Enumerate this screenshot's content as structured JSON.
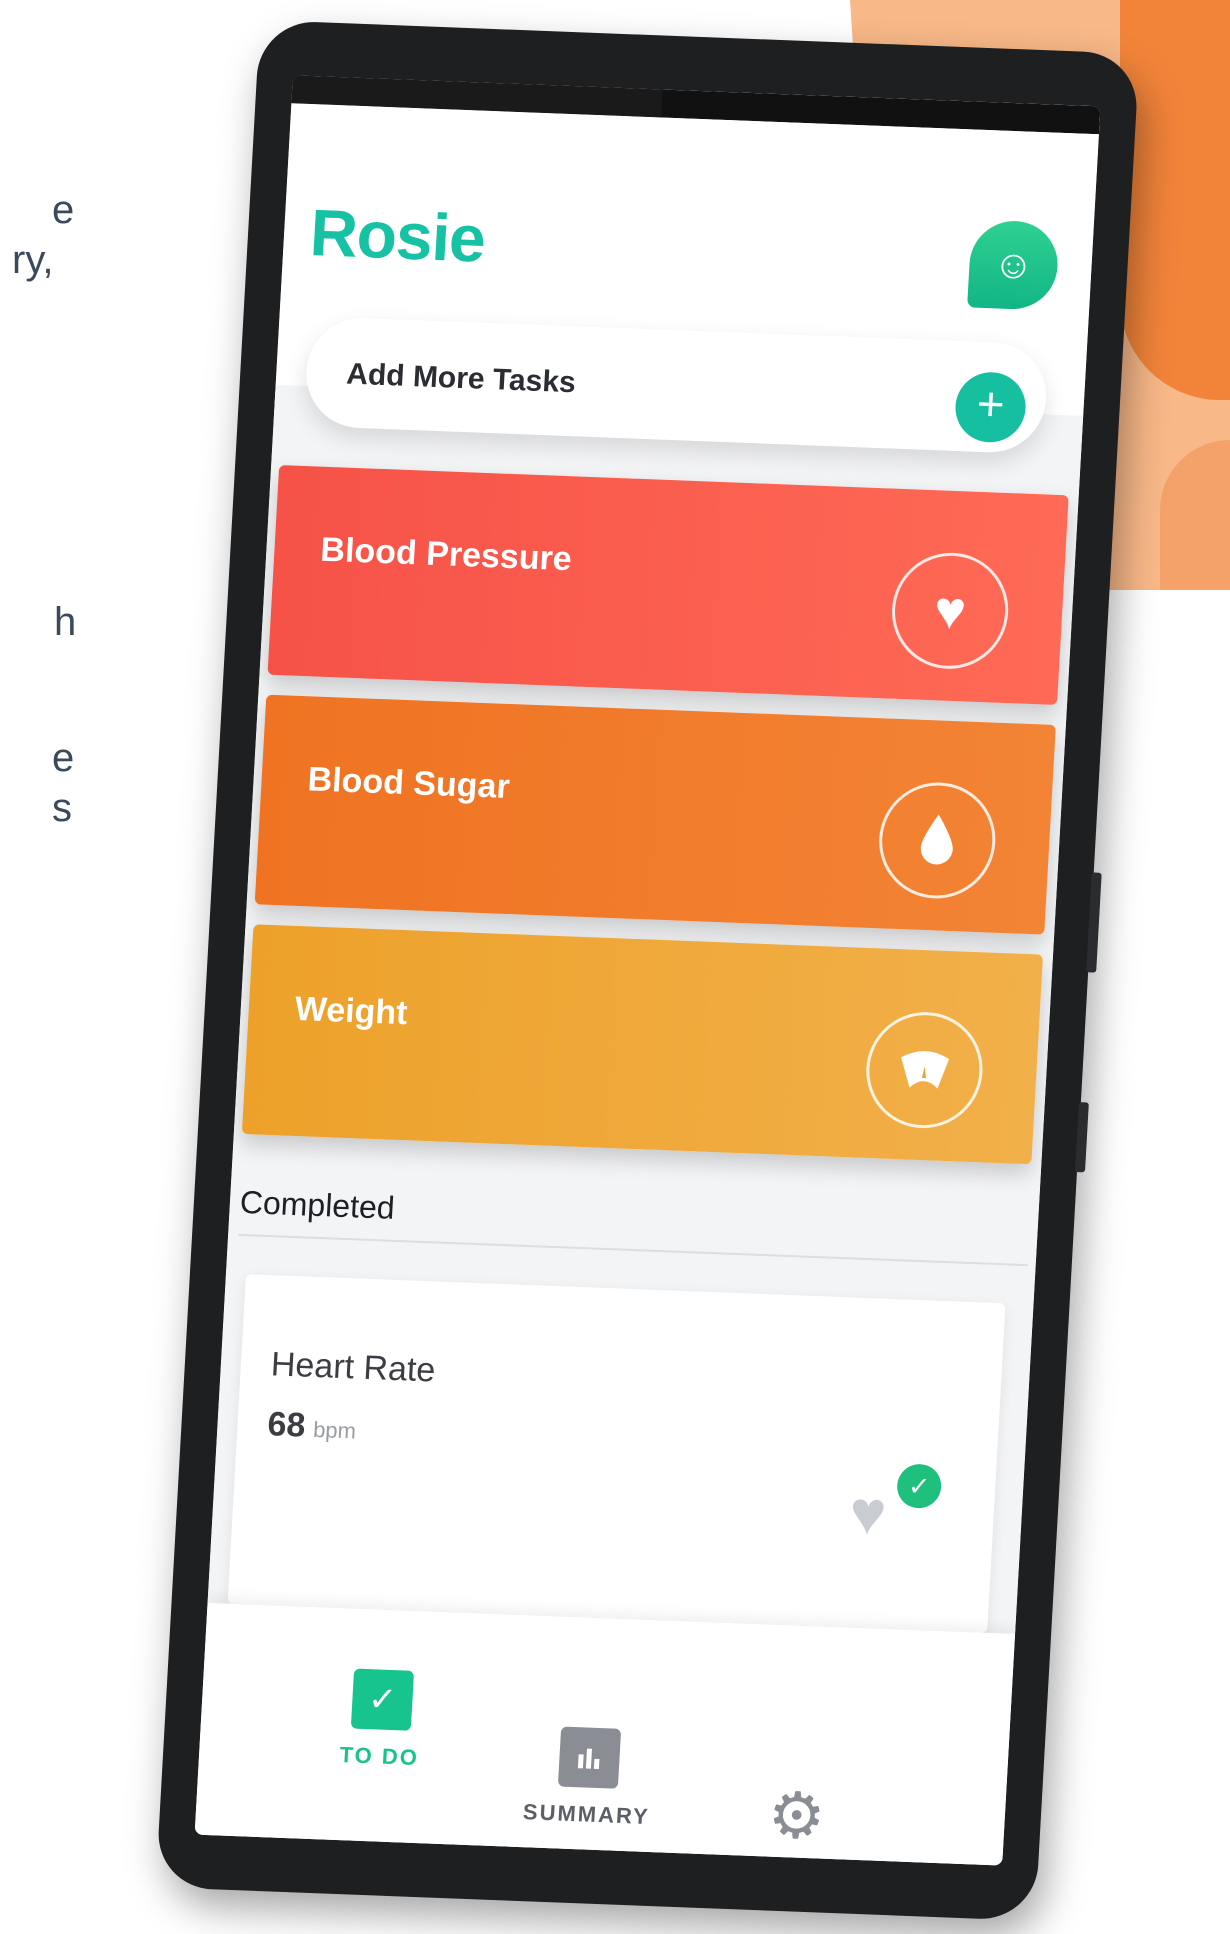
{
  "side_text": [
    "e",
    "ry,",
    "h",
    "e",
    "s"
  ],
  "app": {
    "logo": "Rosie",
    "avatar_icon": "smile-chat-icon"
  },
  "add_task": {
    "label": "Add More Tasks",
    "button_icon": "plus-icon"
  },
  "tasks": [
    {
      "label": "Blood Pressure",
      "icon": "heart-icon",
      "color": "#f65248"
    },
    {
      "label": "Blood Sugar",
      "icon": "drop-icon",
      "color": "#ef7322"
    },
    {
      "label": "Weight",
      "icon": "scale-icon",
      "color": "#eda12a"
    }
  ],
  "completed": {
    "heading": "Completed",
    "items": [
      {
        "title": "Heart Rate",
        "value": "68",
        "unit": "bpm",
        "icon": "heart-rate-check-icon"
      }
    ]
  },
  "nav": {
    "todo": "TO DO",
    "summary": "SUMMARY",
    "settings": "SETTINGS"
  },
  "colors": {
    "brand": "#16c2a3",
    "active_nav": "#18c48d"
  }
}
